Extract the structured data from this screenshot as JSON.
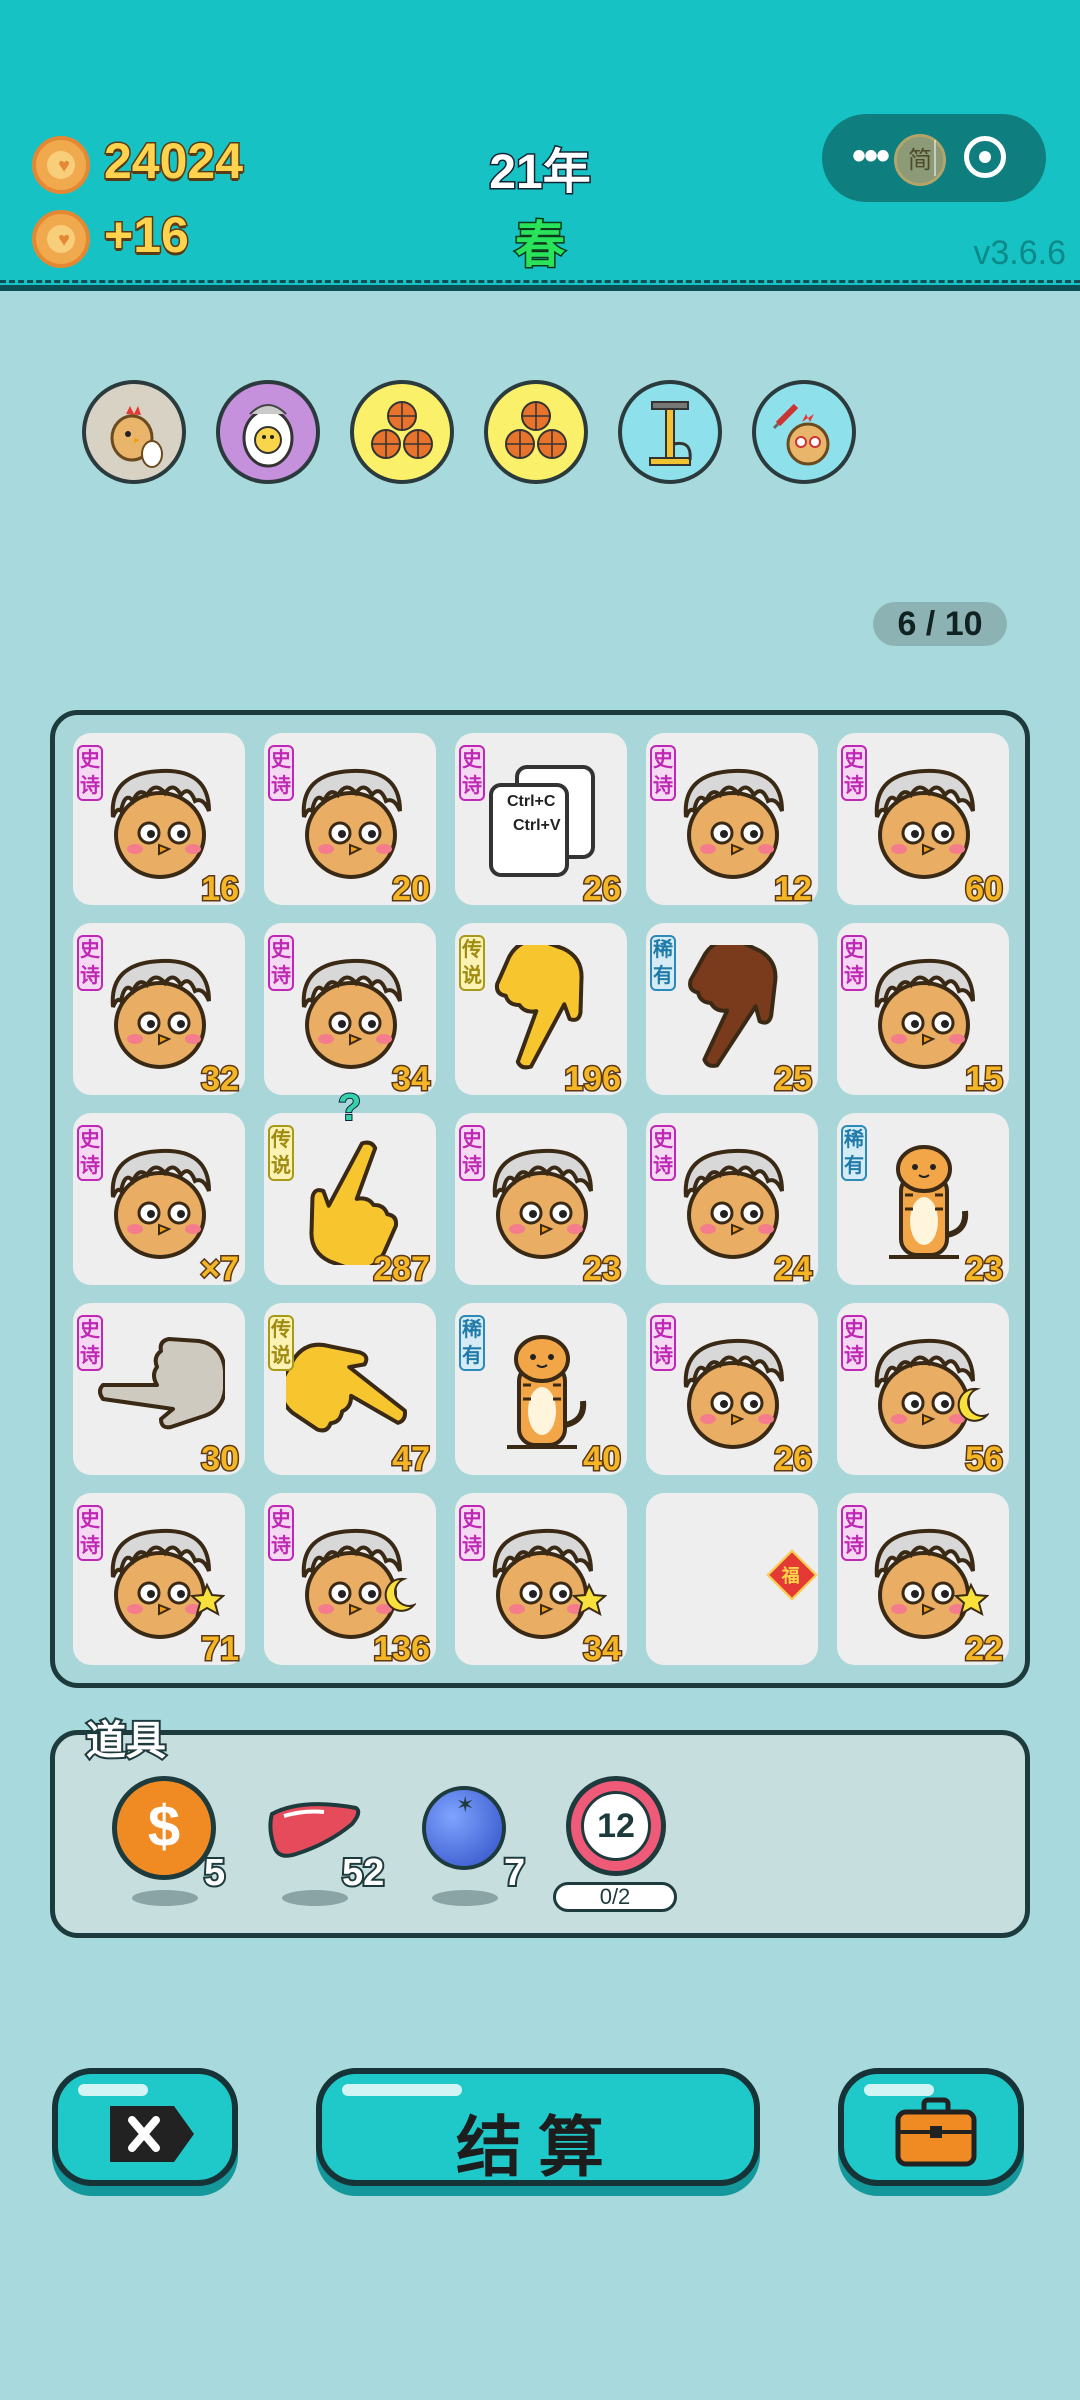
{
  "header": {
    "coins": "24024",
    "income": "+16",
    "year": "21年",
    "season": "春",
    "version": "v3.6.6",
    "capsule_stamp": "简",
    "more_icon": "more-dots-icon",
    "close_icon": "target-close-icon"
  },
  "abilities": [
    {
      "icon": "hen-with-egg-icon"
    },
    {
      "icon": "cracked-egg-chick-icon"
    },
    {
      "icon": "triple-basketball-icon"
    },
    {
      "icon": "triple-basketball-icon"
    },
    {
      "icon": "air-pump-icon"
    },
    {
      "icon": "syringe-chick-icon"
    }
  ],
  "progress": "6 / 10",
  "board": [
    {
      "tag": "史诗",
      "kind": "epic",
      "art": "ikun-chick",
      "value": "16"
    },
    {
      "tag": "史诗",
      "kind": "epic",
      "art": "ikun-chick",
      "value": "20"
    },
    {
      "tag": "史诗",
      "kind": "epic",
      "art": "ctrl-cards",
      "value": "26",
      "ctrl1": "Ctrl+C",
      "ctrl2": "Ctrl+V"
    },
    {
      "tag": "史诗",
      "kind": "epic",
      "art": "ikun-chick",
      "value": "12"
    },
    {
      "tag": "史诗",
      "kind": "epic",
      "art": "ikun-chick",
      "value": "60"
    },
    {
      "tag": "史诗",
      "kind": "epic",
      "art": "ikun-chick",
      "value": "32"
    },
    {
      "tag": "史诗",
      "kind": "epic",
      "art": "ikun-chick",
      "value": "34"
    },
    {
      "tag": "传说",
      "kind": "legend",
      "art": "hand-yellow-down",
      "value": "196"
    },
    {
      "tag": "稀有",
      "kind": "rare",
      "art": "hand-brown-down",
      "value": "25"
    },
    {
      "tag": "史诗",
      "kind": "epic",
      "art": "ikun-chick",
      "value": "15"
    },
    {
      "tag": "史诗",
      "kind": "epic",
      "art": "ikun-chick",
      "value": "×7"
    },
    {
      "tag": "传说",
      "kind": "legend",
      "art": "hand-yellow-up",
      "value": "287",
      "mark": "?"
    },
    {
      "tag": "史诗",
      "kind": "epic",
      "art": "ikun-chick",
      "value": "23"
    },
    {
      "tag": "史诗",
      "kind": "epic",
      "art": "ikun-chick",
      "value": "24"
    },
    {
      "tag": "稀有",
      "kind": "rare",
      "art": "tiger",
      "value": "23"
    },
    {
      "tag": "史诗",
      "kind": "epic",
      "art": "hand-gray-left",
      "value": "30"
    },
    {
      "tag": "传说",
      "kind": "legend",
      "art": "hand-yellow-right",
      "value": "47"
    },
    {
      "tag": "稀有",
      "kind": "rare",
      "art": "tiger",
      "value": "40"
    },
    {
      "tag": "史诗",
      "kind": "epic",
      "art": "ikun-chick",
      "value": "26"
    },
    {
      "tag": "史诗",
      "kind": "epic",
      "art": "ikun-chick-moon",
      "value": "56"
    },
    {
      "tag": "史诗",
      "kind": "epic",
      "art": "ikun-chick-star",
      "value": "71"
    },
    {
      "tag": "史诗",
      "kind": "epic",
      "art": "ikun-chick-moon",
      "value": "136"
    },
    {
      "tag": "史诗",
      "kind": "epic",
      "art": "ikun-chick-star",
      "value": "34"
    },
    {
      "tag": "",
      "kind": "empty",
      "art": "fu",
      "value": "",
      "fu": "福"
    },
    {
      "tag": "史诗",
      "kind": "epic",
      "art": "ikun-chick-star",
      "value": "22"
    }
  ],
  "props": {
    "title": "道具",
    "items": [
      {
        "icon": "coin-dollar-icon",
        "symbol": "$",
        "count": "5"
      },
      {
        "icon": "liver-icon",
        "count": "52"
      },
      {
        "icon": "blueberry-icon",
        "count": "7"
      },
      {
        "icon": "timer-12-icon",
        "label": "12",
        "progress": "0/2"
      }
    ]
  },
  "buttons": {
    "exit_icon": "exit-x-icon",
    "settle_label": "结算",
    "bag_icon": "briefcase-icon"
  },
  "colors": {
    "header": "#17c2c4",
    "background": "#a8dadd",
    "epic": "#bf28b5",
    "legend": "#a79a1a",
    "rare": "#2b8ab8"
  }
}
